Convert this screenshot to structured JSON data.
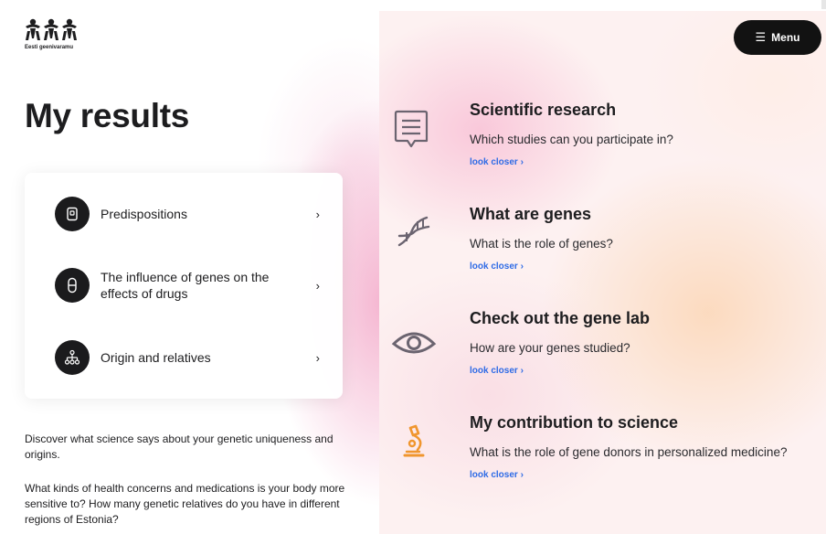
{
  "header": {
    "logo_text": "Eesti geenivaramu",
    "menu_label": "Menu",
    "menu_icon": "hamburger-icon"
  },
  "main": {
    "title": "My results",
    "results": [
      {
        "label": "Predispositions",
        "icon": "document-icon"
      },
      {
        "label": "The influence of genes on the effects of drugs",
        "icon": "pill-icon"
      },
      {
        "label": "Origin and relatives",
        "icon": "family-tree-icon"
      }
    ],
    "intro": [
      "Discover what science says about your genetic uniqueness and origins.",
      "What kinds of health concerns and medications is your body more sensitive to? How many genetic relatives do you have in different regions of Estonia?"
    ]
  },
  "topics": [
    {
      "title": "Scientific research",
      "description": "Which studies can you participate in?",
      "link": "look closer",
      "icon": "speech-document-icon"
    },
    {
      "title": "What are genes",
      "description": "What is the role of genes?",
      "link": "look closer",
      "icon": "dna-icon"
    },
    {
      "title": "Check out the gene lab",
      "description": "How are your genes studied?",
      "link": "look closer",
      "icon": "eye-icon"
    },
    {
      "title": "My contribution to science",
      "description": "What is the role of gene donors in personalized medicine?",
      "link": "look closer",
      "icon": "microscope-icon"
    }
  ],
  "colors": {
    "accent_link": "#2e6be6",
    "dark": "#121212",
    "icon_muted": "#6b6470",
    "icon_orange": "#f0962e"
  }
}
